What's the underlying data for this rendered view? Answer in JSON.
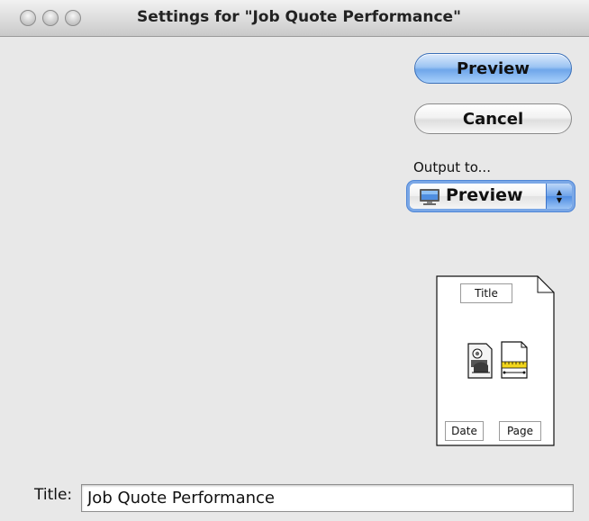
{
  "window": {
    "title": "Settings for \"Job Quote Performance\""
  },
  "buttons": {
    "preview_label": "Preview",
    "cancel_label": "Cancel"
  },
  "output": {
    "label": "Output to...",
    "selected": "Preview",
    "icon": "monitor-icon"
  },
  "layout_preview": {
    "title_slot": "Title",
    "date_slot": "Date",
    "page_slot": "Page",
    "icons": [
      "contacts-icon",
      "document-ruler-icon"
    ]
  },
  "title_field": {
    "label": "Title:",
    "value": "Job Quote Performance"
  },
  "colors": {
    "accent": "#6fa6ea",
    "background": "#e8e8e8"
  }
}
